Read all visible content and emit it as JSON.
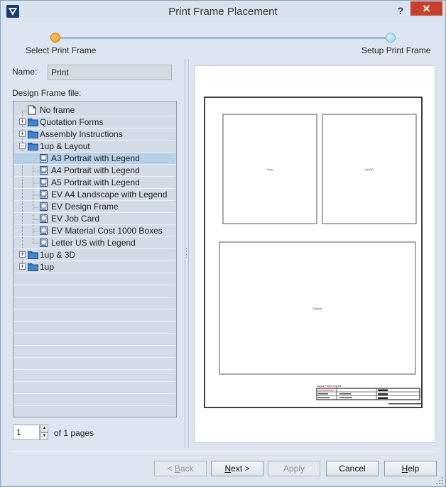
{
  "window": {
    "title": "Print Frame Placement",
    "help_glyph": "?",
    "close_glyph": "✕"
  },
  "steps": [
    {
      "label": "Select Print Frame",
      "state": "current"
    },
    {
      "label": "Setup Print Frame",
      "state": "upcoming"
    }
  ],
  "form": {
    "name_label": "Name:",
    "name_value": "Print",
    "design_frame_label": "Design Frame file:"
  },
  "tree": {
    "items": [
      {
        "label": "No frame",
        "level": 1,
        "icon": "document-icon",
        "expander": ""
      },
      {
        "label": "Quotation Forms",
        "level": 1,
        "icon": "folder-icon",
        "expander": "+"
      },
      {
        "label": "Assembly Instructions",
        "level": 1,
        "icon": "folder-icon",
        "expander": "+"
      },
      {
        "label": "1up & Layout",
        "level": 1,
        "icon": "folder-icon",
        "expander": "−"
      },
      {
        "label": "A3 Portrait with Legend",
        "level": 2,
        "icon": "frame-icon",
        "expander": "",
        "selected": true
      },
      {
        "label": "A4 Portrait with Legend",
        "level": 2,
        "icon": "frame-icon",
        "expander": ""
      },
      {
        "label": "A5 Portrait with Legend",
        "level": 2,
        "icon": "frame-icon",
        "expander": ""
      },
      {
        "label": "EV A4 Landscape with Legend",
        "level": 2,
        "icon": "frame-icon",
        "expander": ""
      },
      {
        "label": "EV Design Frame",
        "level": 2,
        "icon": "frame-icon",
        "expander": ""
      },
      {
        "label": "EV Job Card",
        "level": 2,
        "icon": "frame-icon",
        "expander": ""
      },
      {
        "label": "EV Material Cost 1000 Boxes",
        "level": 2,
        "icon": "frame-icon",
        "expander": ""
      },
      {
        "label": "Letter US with Legend",
        "level": 2,
        "icon": "frame-icon",
        "expander": ""
      },
      {
        "label": "1up & 3D",
        "level": 1,
        "icon": "folder-icon",
        "expander": "+"
      },
      {
        "label": "1up",
        "level": 1,
        "icon": "folder-icon",
        "expander": "+"
      }
    ]
  },
  "pager": {
    "current_page": "1",
    "of_text": "of 1 pages"
  },
  "preview": {
    "box1_label": "Only",
    "box2_label": "Info3D",
    "box3_label": "Layout",
    "legend_title": "Layout Frame Legend"
  },
  "buttons": {
    "back": {
      "prefix": "< ",
      "mnemonic": "B",
      "rest": "ack"
    },
    "next": {
      "prefix": "",
      "mnemonic": "N",
      "rest": "ext >"
    },
    "apply": "Apply",
    "cancel": "Cancel",
    "help": {
      "prefix": "",
      "mnemonic": "H",
      "rest": "elp"
    }
  },
  "colors": {
    "accent_current_step": "#f29a22",
    "upcoming_step": "#8fcbe6",
    "close_button": "#c7402c",
    "selected_row": "#b7cfe7"
  }
}
